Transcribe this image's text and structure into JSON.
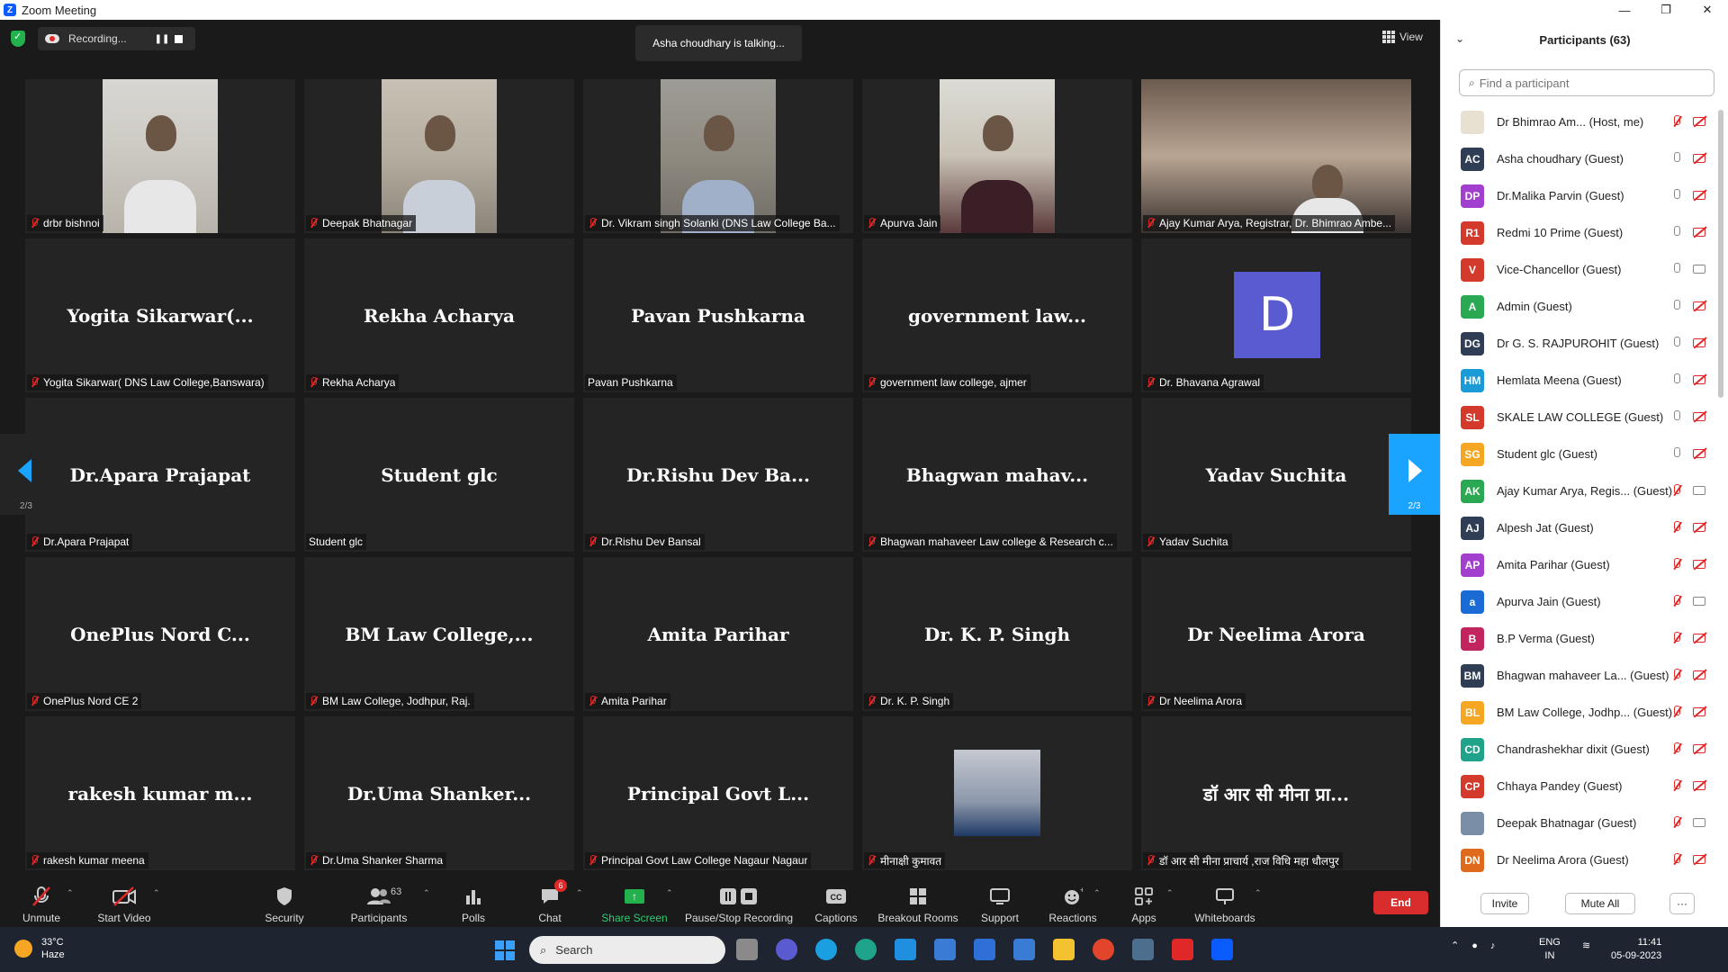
{
  "window": {
    "title": "Zoom Meeting",
    "minimize": "—",
    "maximize": "❐",
    "close": "✕"
  },
  "topbar": {
    "recording_label": "Recording...",
    "talking": "Asha choudhary is talking...",
    "view_label": "View"
  },
  "tiles": [
    {
      "name": "drbr bishnoi",
      "big": "",
      "video": true
    },
    {
      "name": "Deepak Bhatnagar",
      "big": "",
      "video": true
    },
    {
      "name": "Dr. Vikram singh Solanki (DNS Law College Ba...",
      "big": "",
      "video": true
    },
    {
      "name": "Apurva Jain",
      "big": "",
      "video": true
    },
    {
      "name": "Ajay Kumar Arya, Registrar, Dr. Bhimrao Ambe...",
      "big": "",
      "video": true
    },
    {
      "name": "Yogita Sikarwar( DNS Law College,Banswara)",
      "big": "Yogita  Sikarwar(..."
    },
    {
      "name": "Rekha Acharya",
      "big": "Rekha Acharya"
    },
    {
      "name": "Pavan Pushkarna",
      "big": "Pavan Pushkarna",
      "unmuted": true
    },
    {
      "name": "government law college, ajmer",
      "big": "government  law..."
    },
    {
      "name": "Dr. Bhavana Agrawal",
      "big": "",
      "avatar": "D"
    },
    {
      "name": "Dr.Apara Prajapat",
      "big": "Dr.Apara Prajapat"
    },
    {
      "name": "Student glc",
      "big": "Student glc",
      "unmuted": true
    },
    {
      "name": "Dr.Rishu Dev Bansal",
      "big": "Dr.Rishu  Dev  Ba..."
    },
    {
      "name": "Bhagwan mahaveer Law college  & Research c...",
      "big": "Bhagwan  mahav..."
    },
    {
      "name": "Yadav Suchita",
      "big": "Yadav Suchita"
    },
    {
      "name": "OnePlus Nord CE 2",
      "big": "OnePlus  Nord  C..."
    },
    {
      "name": "BM Law College, Jodhpur, Raj.",
      "big": "BM  Law  College,..."
    },
    {
      "name": "Amita Parihar",
      "big": "Amita Parihar"
    },
    {
      "name": "Dr. K. P. Singh",
      "big": "Dr. K. P. Singh"
    },
    {
      "name": "Dr Neelima Arora",
      "big": "Dr Neelima Arora"
    },
    {
      "name": "rakesh kumar meena",
      "big": "rakesh  kumar  m..."
    },
    {
      "name": "Dr.Uma Shanker Sharma",
      "big": "Dr.Uma  Shanker..."
    },
    {
      "name": "Principal Govt Law College Nagaur Nagaur",
      "big": "Principal  Govt  L..."
    },
    {
      "name": "मीनाक्षी कुमावत",
      "big": "",
      "photo": true
    },
    {
      "name": "डॉ आर सी मीना प्राचार्य ,राज विधि महा धौलपुर",
      "big": "डॉ आर सी मीना प्रा..."
    }
  ],
  "pager": {
    "left": "2/3",
    "right": "2/3"
  },
  "toolbar": {
    "unmute": "Unmute",
    "start_video": "Start Video",
    "security": "Security",
    "participants": "Participants",
    "participants_count": "63",
    "polls": "Polls",
    "chat": "Chat",
    "chat_badge": "6",
    "share_screen": "Share Screen",
    "pause_stop": "Pause/Stop Recording",
    "captions": "Captions",
    "breakout": "Breakout Rooms",
    "support": "Support",
    "reactions": "Reactions",
    "apps": "Apps",
    "whiteboards": "Whiteboards",
    "end": "End"
  },
  "panel": {
    "title": "Participants (63)",
    "search_placeholder": "Find a participant",
    "invite": "Invite",
    "mute_all": "Mute All",
    "more": "···",
    "participants": [
      {
        "initials": "",
        "name": "Dr Bhimrao Am...  (Host, me)",
        "color": "#e8e0d0",
        "mic": "muted",
        "video": "off"
      },
      {
        "initials": "AC",
        "name": "Asha choudhary (Guest)",
        "color": "#2f3e55",
        "mic": "on",
        "video": "off"
      },
      {
        "initials": "DP",
        "name": "Dr.Malika Parvin (Guest)",
        "color": "#a33fcf",
        "mic": "on",
        "video": "off"
      },
      {
        "initials": "R1",
        "name": "Redmi 10 Prime (Guest)",
        "color": "#d33a2c",
        "mic": "on",
        "video": "off"
      },
      {
        "initials": "V",
        "name": "Vice-Chancellor (Guest)",
        "color": "#d33a2c",
        "mic": "on",
        "video": "on"
      },
      {
        "initials": "A",
        "name": "Admin (Guest)",
        "color": "#2aa952",
        "mic": "on",
        "video": "off"
      },
      {
        "initials": "DG",
        "name": "Dr G. S. RAJPUROHIT (Guest)",
        "color": "#2f3e55",
        "mic": "on",
        "video": "off"
      },
      {
        "initials": "HM",
        "name": "Hemlata Meena (Guest)",
        "color": "#1a9ad6",
        "mic": "on",
        "video": "off"
      },
      {
        "initials": "SL",
        "name": "SKALE LAW COLLEGE (Guest)",
        "color": "#d33a2c",
        "mic": "on",
        "video": "off"
      },
      {
        "initials": "SG",
        "name": "Student glc (Guest)",
        "color": "#f5a623",
        "mic": "on",
        "video": "off"
      },
      {
        "initials": "AK",
        "name": "Ajay Kumar Arya, Regis...  (Guest)",
        "color": "#2aa952",
        "mic": "muted",
        "video": "on"
      },
      {
        "initials": "AJ",
        "name": "Alpesh Jat (Guest)",
        "color": "#2f3e55",
        "mic": "muted",
        "video": "off"
      },
      {
        "initials": "AP",
        "name": "Amita Parihar (Guest)",
        "color": "#a33fcf",
        "mic": "muted",
        "video": "off"
      },
      {
        "initials": "a",
        "name": "Apurva Jain (Guest)",
        "color": "#1a6bd6",
        "mic": "muted",
        "video": "on"
      },
      {
        "initials": "B",
        "name": "B.P Verma (Guest)",
        "color": "#c2245f",
        "mic": "muted",
        "video": "off"
      },
      {
        "initials": "BM",
        "name": "Bhagwan mahaveer La...  (Guest)",
        "color": "#2f3e55",
        "mic": "muted",
        "video": "off"
      },
      {
        "initials": "BL",
        "name": "BM Law College, Jodhp...  (Guest)",
        "color": "#f5a623",
        "mic": "muted",
        "video": "off"
      },
      {
        "initials": "CD",
        "name": "Chandrashekhar dixit (Guest)",
        "color": "#1fa38a",
        "mic": "muted",
        "video": "off"
      },
      {
        "initials": "CP",
        "name": "Chhaya Pandey (Guest)",
        "color": "#d33a2c",
        "mic": "muted",
        "video": "off"
      },
      {
        "initials": "",
        "name": "Deepak Bhatnagar (Guest)",
        "color": "#7a8ea8",
        "mic": "muted",
        "video": "on"
      },
      {
        "initials": "DN",
        "name": "Dr Neelima Arora (Guest)",
        "color": "#e06a1b",
        "mic": "muted",
        "video": "off"
      }
    ]
  },
  "taskbar": {
    "temp": "33°C",
    "weather": "Haze",
    "search": "Search",
    "lang1": "ENG",
    "lang2": "IN",
    "time": "11:41",
    "date": "05-09-2023"
  }
}
